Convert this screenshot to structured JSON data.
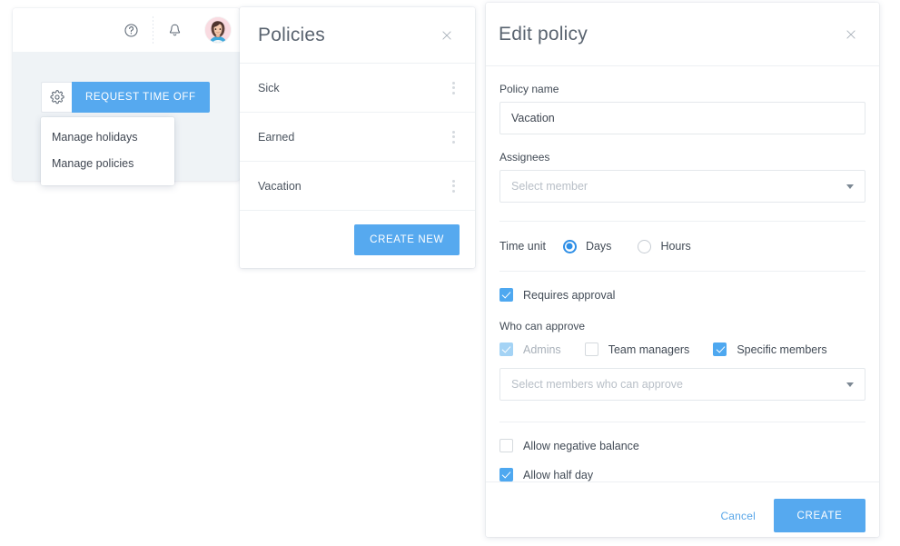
{
  "app": {
    "topbar": {
      "help_icon": "help-circle-icon",
      "bell_icon": "bell-icon",
      "avatar_alt": "user-avatar"
    },
    "settings_gear_icon": "gear-icon",
    "request_time_off_label": "REQUEST TIME OFF",
    "menu": {
      "items": [
        {
          "label": "Manage holidays"
        },
        {
          "label": "Manage policies"
        }
      ]
    }
  },
  "policies_panel": {
    "title": "Policies",
    "close_icon": "close-icon",
    "kebab_icon": "more-vertical-icon",
    "rows": [
      {
        "name": "Sick"
      },
      {
        "name": "Earned"
      },
      {
        "name": "Vacation"
      }
    ],
    "create_new_label": "CREATE NEW"
  },
  "edit_panel": {
    "title": "Edit policy",
    "close_icon": "close-icon",
    "policy_name": {
      "label": "Policy name",
      "value": "Vacation"
    },
    "assignees": {
      "label": "Assignees",
      "placeholder": "Select member",
      "value": "",
      "caret_icon": "chevron-down-icon"
    },
    "time_unit": {
      "label": "Time unit",
      "options": [
        {
          "label": "Days",
          "selected": true
        },
        {
          "label": "Hours",
          "selected": false
        }
      ]
    },
    "requires_approval": {
      "label": "Requires approval",
      "checked": true
    },
    "who_can_approve": {
      "label": "Who can approve",
      "options": [
        {
          "label": "Admins",
          "checked": true,
          "disabled": true
        },
        {
          "label": "Team managers",
          "checked": false,
          "disabled": false
        },
        {
          "label": "Specific members",
          "checked": true,
          "disabled": false
        }
      ],
      "members_placeholder": "Select members who can approve",
      "caret_icon": "chevron-down-icon"
    },
    "allow_negative_balance": {
      "label": "Allow negative balance",
      "checked": false
    },
    "allow_half_day": {
      "label": "Allow half day",
      "checked": true
    },
    "cancel_label": "Cancel",
    "create_label": "CREATE"
  },
  "colors": {
    "accent_blue": "#56a9ef",
    "radio_blue": "#2f8fe6",
    "checkbox_blue": "#4ea8f0",
    "checkbox_disabled_blue": "#a4d3f5",
    "panel_bg": "#ffffff",
    "app_bg": "#eff3f6",
    "link_blue": "#59a6e8"
  }
}
